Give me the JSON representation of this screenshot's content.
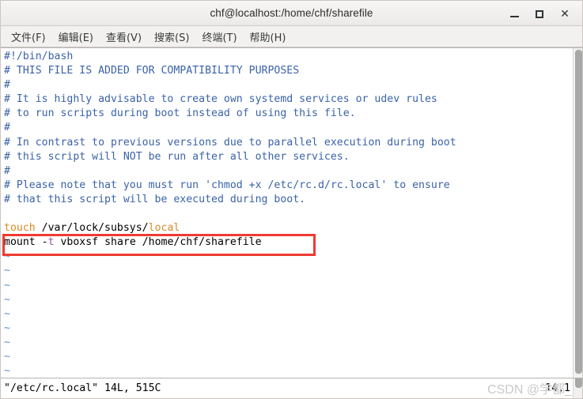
{
  "window": {
    "title": "chf@localhost:/home/chf/sharefile",
    "buttons": {
      "minimize": "minimize-button",
      "maximize": "maximize-button",
      "close": "close-button"
    }
  },
  "menubar": {
    "items": [
      {
        "label": "文件(F)"
      },
      {
        "label": "编辑(E)"
      },
      {
        "label": "查看(V)"
      },
      {
        "label": "搜索(S)"
      },
      {
        "label": "终端(T)"
      },
      {
        "label": "帮助(H)"
      }
    ]
  },
  "editor": {
    "lines": [
      {
        "segments": [
          {
            "text": "#!/bin/bash",
            "color": "comment"
          }
        ]
      },
      {
        "segments": [
          {
            "text": "# THIS FILE IS ADDED FOR COMPATIBILITY PURPOSES",
            "color": "comment"
          }
        ]
      },
      {
        "segments": [
          {
            "text": "#",
            "color": "comment"
          }
        ]
      },
      {
        "segments": [
          {
            "text": "# It is highly advisable to create own systemd services or udev rules",
            "color": "comment"
          }
        ]
      },
      {
        "segments": [
          {
            "text": "# to run scripts during boot instead of using this file.",
            "color": "comment"
          }
        ]
      },
      {
        "segments": [
          {
            "text": "#",
            "color": "comment"
          }
        ]
      },
      {
        "segments": [
          {
            "text": "# In contrast to previous versions due to parallel execution during boot",
            "color": "comment"
          }
        ]
      },
      {
        "segments": [
          {
            "text": "# this script will NOT be run after all other services.",
            "color": "comment"
          }
        ]
      },
      {
        "segments": [
          {
            "text": "#",
            "color": "comment"
          }
        ]
      },
      {
        "segments": [
          {
            "text": "# Please note that you must run 'chmod +x /etc/rc.d/rc.local' to ensure",
            "color": "comment"
          }
        ]
      },
      {
        "segments": [
          {
            "text": "# that this script will be executed during boot.",
            "color": "comment"
          }
        ]
      },
      {
        "segments": [
          {
            "text": "",
            "color": "plain"
          }
        ]
      },
      {
        "segments": [
          {
            "text": "touch",
            "color": "orange"
          },
          {
            "text": " /var/lock/subsys/",
            "color": "plain"
          },
          {
            "text": "local",
            "color": "orange"
          }
        ]
      },
      {
        "segments": [
          {
            "text": "mount ",
            "color": "plain"
          },
          {
            "text": "-",
            "color": "plain"
          },
          {
            "text": "t",
            "color": "purple"
          },
          {
            "text": " vboxsf share /home/chf/sharefile",
            "color": "plain"
          }
        ]
      },
      {
        "segments": [
          {
            "text": "~",
            "color": "tilde"
          }
        ]
      },
      {
        "segments": [
          {
            "text": "~",
            "color": "tilde"
          }
        ]
      },
      {
        "segments": [
          {
            "text": "~",
            "color": "tilde"
          }
        ]
      },
      {
        "segments": [
          {
            "text": "~",
            "color": "tilde"
          }
        ]
      },
      {
        "segments": [
          {
            "text": "~",
            "color": "tilde"
          }
        ]
      },
      {
        "segments": [
          {
            "text": "~",
            "color": "tilde"
          }
        ]
      },
      {
        "segments": [
          {
            "text": "~",
            "color": "tilde"
          }
        ]
      },
      {
        "segments": [
          {
            "text": "~",
            "color": "tilde"
          }
        ]
      },
      {
        "segments": [
          {
            "text": "~",
            "color": "tilde"
          }
        ]
      }
    ],
    "highlight": {
      "color": "#ee3b32",
      "target_text": "mount -t vboxsf share /home/chf/sharefile"
    }
  },
  "statusbar": {
    "file_info": "\"/etc/rc.local\" 14L, 515C",
    "cursor_position": "14,1",
    "watermark": "CSDN @学都_"
  },
  "colors": {
    "comment": "#3a63a8",
    "orange": "#d98a23",
    "plain": "#000000",
    "purple": "#9a50a8",
    "tilde": "#5b8fd0",
    "highlight": "#ee3b32",
    "terminal_bg": "#ffffff",
    "chrome_bg": "#f2f1f0"
  }
}
